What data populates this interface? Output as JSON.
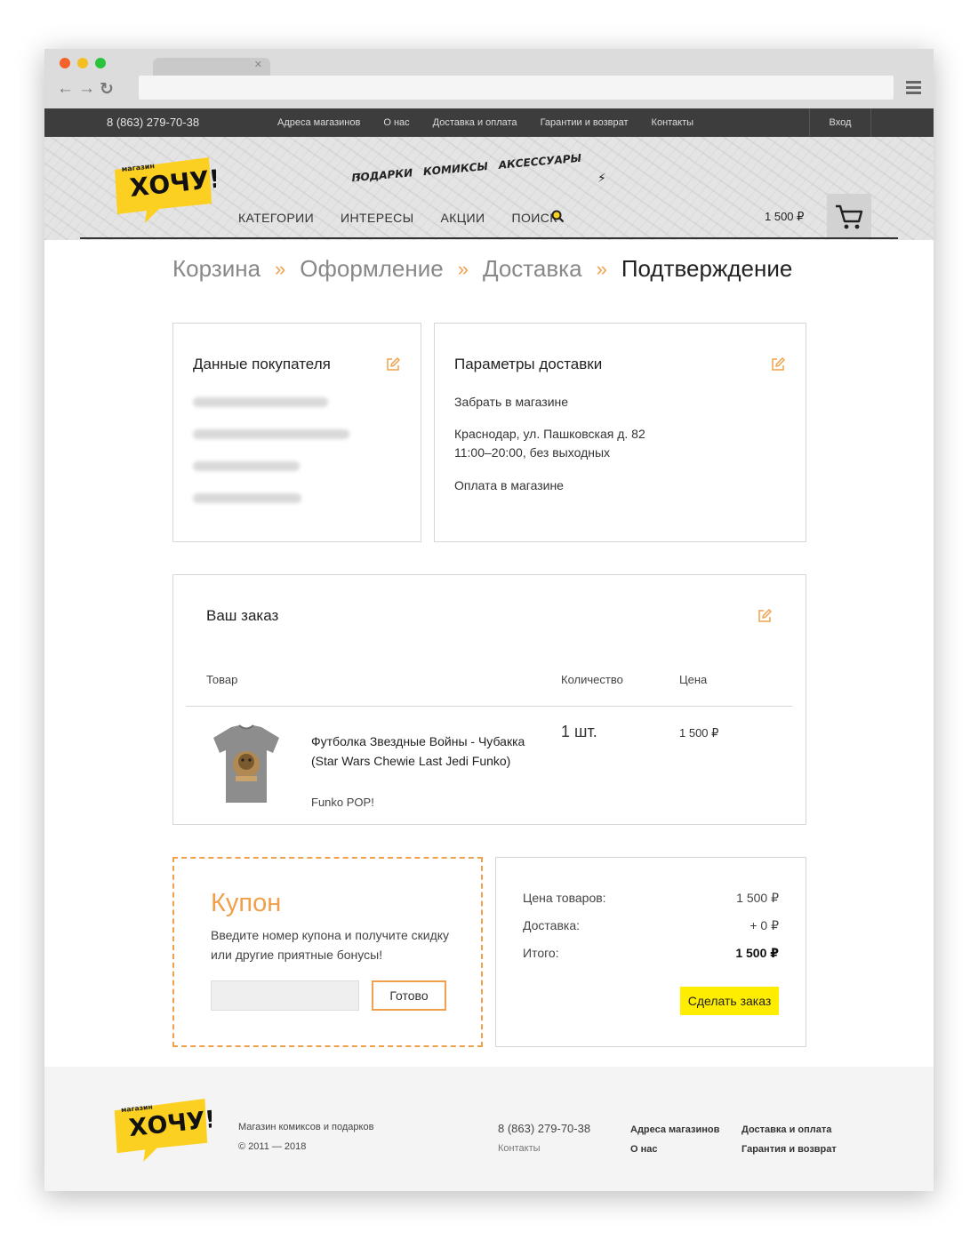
{
  "topbar": {
    "phone": "8 (863) 279-70-38",
    "links": [
      "Адреса магазинов",
      "О нас",
      "Доставка и оплата",
      "Гарантии и возврат",
      "Контакты"
    ],
    "login": "Вход"
  },
  "logo": {
    "small": "магазин",
    "big": "ХОЧУ!"
  },
  "slogan": [
    "ПОДАРКИ",
    "КОМИКСЫ",
    "АКСЕССУАРЫ"
  ],
  "menu": [
    "КАТЕГОРИИ",
    "ИНТЕРЕСЫ",
    "АКЦИИ",
    "ПОИСК"
  ],
  "cart": {
    "sum": "1 500 ₽"
  },
  "steps": {
    "items": [
      "Корзина",
      "Оформление",
      "Доставка",
      "Подтверждение"
    ],
    "separator": "»"
  },
  "buyer": {
    "title": "Данные покупателя"
  },
  "delivery": {
    "title": "Параметры доставки",
    "method": "Забрать в магазине",
    "address": "Краснодар, ул. Пашковская д. 82",
    "hours": "11:00–20:00, без выходных",
    "payment": "Оплата в магазине"
  },
  "order": {
    "title": "Ваш заказ",
    "columns": {
      "product": "Товар",
      "quantity": "Количество",
      "price": "Цена"
    },
    "items": [
      {
        "name": "Футболка Звездные Войны - Чубакка (Star Wars Chewie Last Jedi Funko)",
        "brand": "Funko POP!",
        "quantity": "1 шт.",
        "price": "1 500 ₽"
      }
    ]
  },
  "coupon": {
    "title": "Купон",
    "description": "Введите номер купона и получите скидку или другие приятные бонусы!",
    "input_value": "",
    "button": "Готово"
  },
  "totals": {
    "goods_label": "Цена товаров:",
    "goods_value": "1 500 ₽",
    "delivery_label": "Доставка:",
    "delivery_value": "+ 0 ₽",
    "total_label": "Итого:",
    "total_value": "1 500 ₽",
    "submit": "Сделать заказ"
  },
  "footer": {
    "tagline": "Магазин комиксов и подарков",
    "copyright": "© 2011 — 2018",
    "phone": "8 (863) 279-70-38",
    "contacts": "Контакты",
    "links": [
      "Адреса магазинов",
      "О нас",
      "Доставка и оплата",
      "Гарантия и возврат"
    ]
  },
  "colors": {
    "accent": "#f0a04b",
    "cta": "#ffed00",
    "brand_yellow": "#fcd020",
    "topbar": "#3d3d3d"
  }
}
